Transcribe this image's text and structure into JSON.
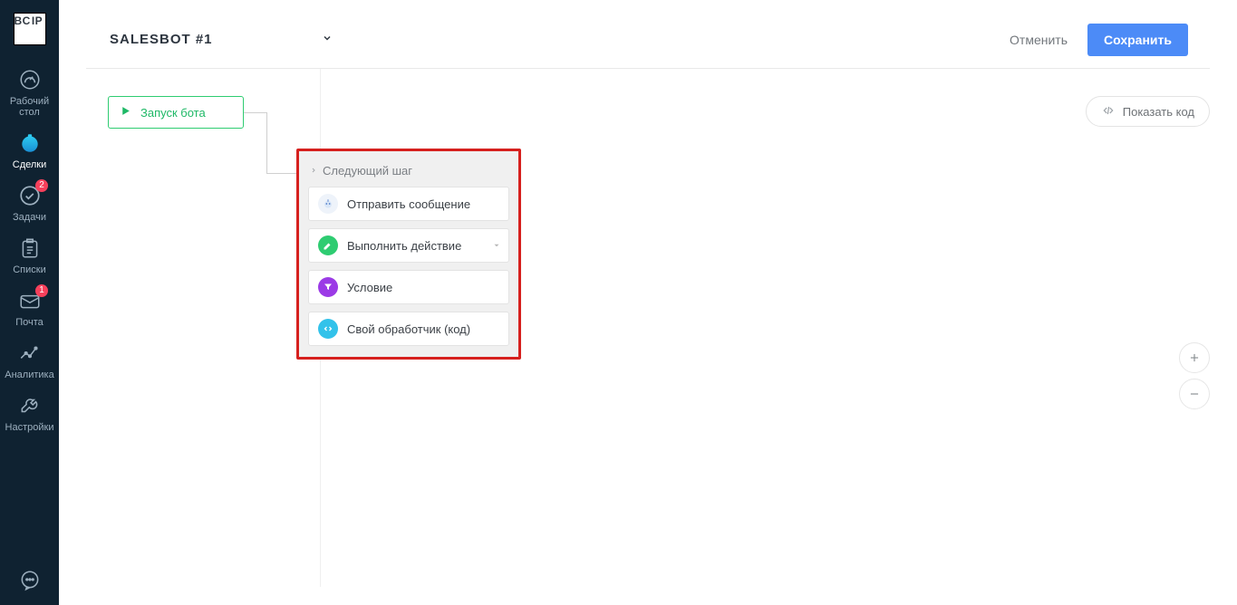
{
  "logo": {
    "l1": "BC",
    "l2": "IP"
  },
  "sidebar": {
    "items": [
      {
        "label": "Рабочий\nстол"
      },
      {
        "label": "Сделки"
      },
      {
        "label": "Задачи",
        "badge": "2"
      },
      {
        "label": "Списки"
      },
      {
        "label": "Почта",
        "badge": "1"
      },
      {
        "label": "Аналитика"
      },
      {
        "label": "Настройки"
      }
    ]
  },
  "topbar": {
    "title": "SALESBOT #1",
    "cancel": "Отменить",
    "save": "Сохранить"
  },
  "start_node": {
    "label": "Запуск бота"
  },
  "step_panel": {
    "header": "Следующий шаг",
    "options": [
      "Отправить сообщение",
      "Выполнить действие",
      "Условие",
      "Свой обработчик (код)"
    ]
  },
  "show_code": {
    "label": "Показать код"
  }
}
